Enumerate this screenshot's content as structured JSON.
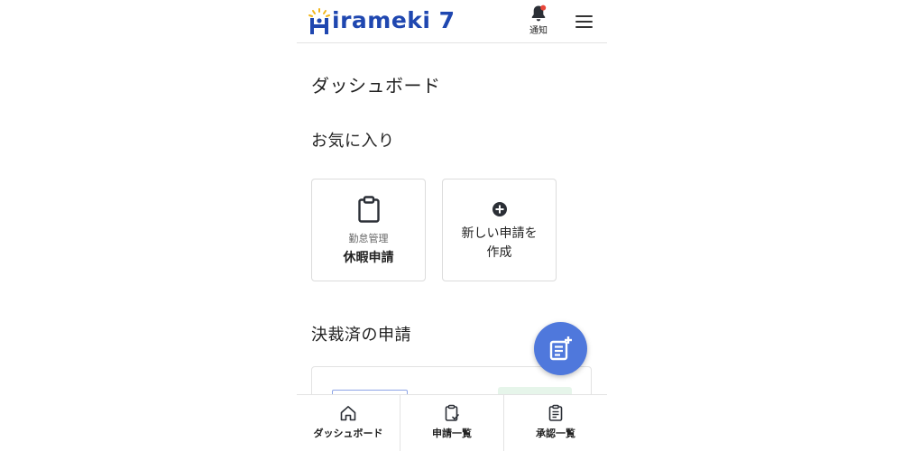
{
  "header": {
    "logo_text": "irameki 7",
    "logo_icon": "hiramekiロゴ-icon",
    "bell_label": "通知",
    "bell_icon": "bell-icon",
    "menu_icon": "hamburger-menu-icon"
  },
  "main": {
    "page_title": "ダッシュボード",
    "favorites_title": "お気に入り",
    "favorites": [
      {
        "category": "勤怠管理",
        "name": "休暇申請",
        "icon": "clipboard-icon"
      },
      {
        "label_line1": "新しい申請を",
        "label_line2": "作成",
        "icon": "plus-circle-icon"
      }
    ],
    "approved_title": "決裁済の申請"
  },
  "fab": {
    "icon": "new-application-icon"
  },
  "bottom_nav": [
    {
      "label": "ダッシュボード",
      "icon": "home-icon"
    },
    {
      "label": "申請一覧",
      "icon": "clipboard-check-icon"
    },
    {
      "label": "承認一覧",
      "icon": "clipboard-list-icon"
    }
  ],
  "colors": {
    "brand_blue": "#1f47b0",
    "fab_blue": "#4f78dc",
    "notification_dot": "#e8463a",
    "logo_spark": "#f2b61b"
  }
}
